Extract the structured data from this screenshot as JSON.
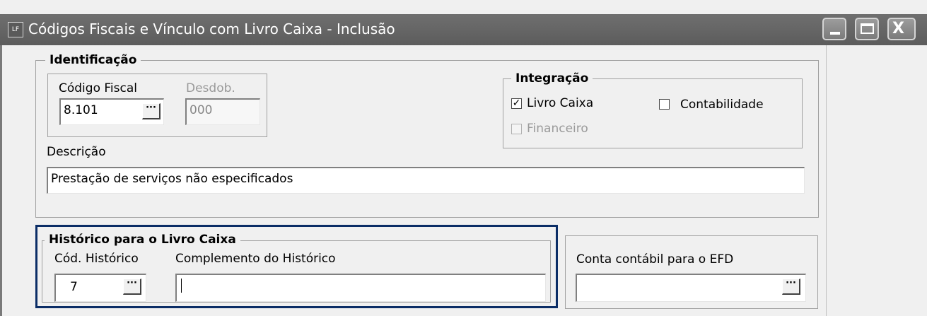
{
  "window": {
    "app_icon": "LF",
    "title": "Códigos Fiscais e Vínculo com Livro Caixa  - Inclusão",
    "minimize_icon": "minimize-icon",
    "maximize_icon": "maximize-icon",
    "close_icon": "close-icon",
    "close_glyph": "X"
  },
  "identificacao": {
    "legend": "Identificação",
    "codigo_fiscal_label": "Código Fiscal",
    "codigo_fiscal_value": "8.101",
    "desdob_label": "Desdob.",
    "desdob_value": "000",
    "descricao_label": "Descrição",
    "descricao_value": "Prestação de serviços não especificados"
  },
  "integracao": {
    "legend": "Integração",
    "livro_caixa": {
      "label": "Livro Caixa",
      "checked": true
    },
    "contabilidade": {
      "label": "Contabilidade",
      "checked": false
    },
    "financeiro": {
      "label": "Financeiro",
      "checked": false,
      "disabled": true
    }
  },
  "historico": {
    "legend": "Histórico para o Livro Caixa",
    "cod_historico_label": "Cód. Histórico",
    "cod_historico_value": "7",
    "complemento_label": "Complemento do Histórico",
    "complemento_value": ""
  },
  "efd": {
    "label": "Conta contábil para o EFD",
    "value": ""
  },
  "browse_button_glyph": "···",
  "accent_color": "#0b2d66"
}
